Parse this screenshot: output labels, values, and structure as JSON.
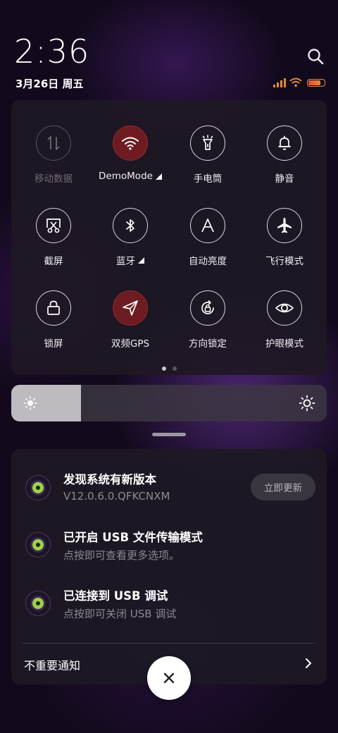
{
  "header": {
    "time": "2:36",
    "date": "3月26日 周五"
  },
  "colors": {
    "active_tile": "#6e1c22",
    "status_accent": "#e08a3c"
  },
  "tiles": [
    {
      "label": "移动数据",
      "icon": "mobile-data-icon",
      "state": "disabled"
    },
    {
      "label": "DemoMode",
      "icon": "wifi-icon",
      "state": "active",
      "has_menu": true
    },
    {
      "label": "手电筒",
      "icon": "flashlight-icon",
      "state": "off"
    },
    {
      "label": "静音",
      "icon": "bell-icon",
      "state": "off"
    },
    {
      "label": "截屏",
      "icon": "screenshot-icon",
      "state": "off"
    },
    {
      "label": "蓝牙",
      "icon": "bluetooth-icon",
      "state": "off",
      "has_menu": true
    },
    {
      "label": "自动亮度",
      "icon": "auto-brightness-icon",
      "state": "off"
    },
    {
      "label": "飞行模式",
      "icon": "airplane-icon",
      "state": "off"
    },
    {
      "label": "锁屏",
      "icon": "lock-icon",
      "state": "off"
    },
    {
      "label": "双频GPS",
      "icon": "gps-icon",
      "state": "active"
    },
    {
      "label": "方向锁定",
      "icon": "rotation-lock-icon",
      "state": "off"
    },
    {
      "label": "护眼模式",
      "icon": "eye-icon",
      "state": "off"
    }
  ],
  "pager": {
    "pages": 2,
    "current": 1
  },
  "brightness": {
    "level": 0.22
  },
  "notifications": [
    {
      "title": "发现系统有新版本",
      "subtitle": "V12.0.6.0.QFKCNXM",
      "action": "立即更新"
    },
    {
      "title": "已开启 USB 文件传输模式",
      "subtitle": "点按即可查看更多选项。"
    },
    {
      "title": "已连接到 USB 调试",
      "subtitle": "点按即可关闭 USB 调试"
    }
  ],
  "unimportant": {
    "label": "不重要通知"
  }
}
